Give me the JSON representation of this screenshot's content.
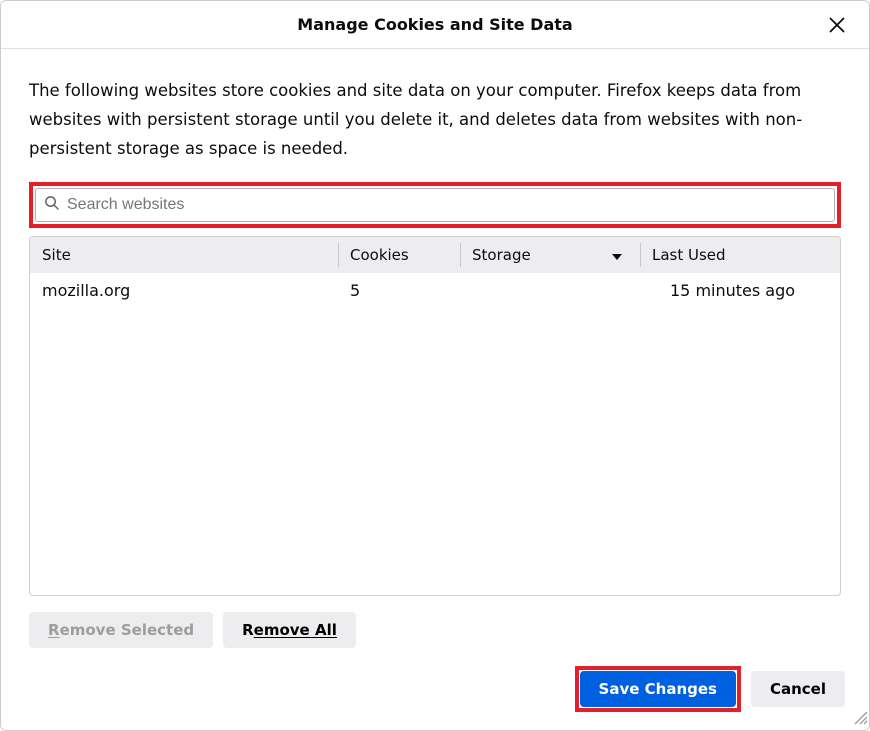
{
  "dialog": {
    "title": "Manage Cookies and Site Data",
    "description": "The following websites store cookies and site data on your computer. Firefox keeps data from websites with persistent storage until you delete it, and deletes data from websites with non-persistent storage as space is needed.",
    "close_label": "Close"
  },
  "search": {
    "placeholder": "Search websites"
  },
  "table": {
    "columns": {
      "site": "Site",
      "cookies": "Cookies",
      "storage": "Storage",
      "last_used": "Last Used"
    },
    "sort_column": "storage",
    "sort_direction": "desc",
    "rows": [
      {
        "site": "mozilla.org",
        "cookies": "5",
        "storage": "",
        "last_used": "15 minutes ago"
      }
    ]
  },
  "actions": {
    "remove_selected_prefix": "R",
    "remove_selected_rest": "emove Selected",
    "remove_all_prefix": "R",
    "remove_all_rest": "emove All",
    "save_changes": "Save Changes",
    "cancel": "Cancel"
  },
  "highlight_color": "#e2202c",
  "primary_color": "#0061e0"
}
